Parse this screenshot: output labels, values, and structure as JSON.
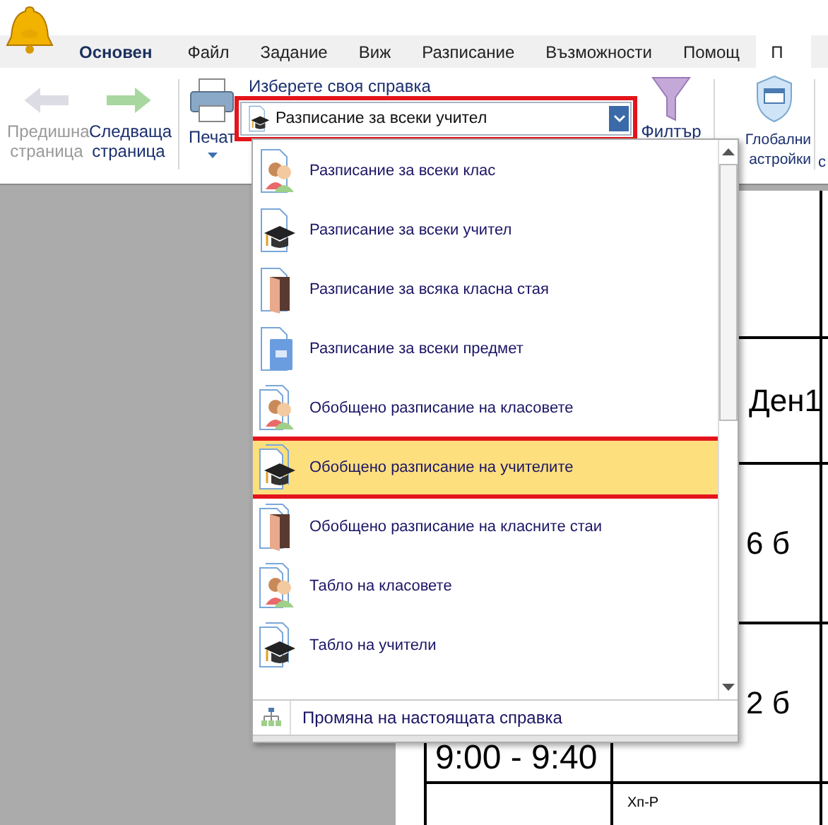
{
  "tabs": [
    {
      "label": "Основен",
      "kind": "app",
      "selected": false
    },
    {
      "label": "Файл",
      "kind": "tab",
      "selected": false
    },
    {
      "label": "Задание",
      "kind": "tab",
      "selected": false
    },
    {
      "label": "Виж",
      "kind": "tab",
      "selected": false
    },
    {
      "label": "Разписание",
      "kind": "tab",
      "selected": false
    },
    {
      "label": "Възможности",
      "kind": "tab",
      "selected": false
    },
    {
      "label": "Помощ",
      "kind": "tab",
      "selected": false
    },
    {
      "label": "П",
      "kind": "tab",
      "selected": true
    }
  ],
  "ribbon": {
    "buttons": [
      {
        "label": "Предишна страница",
        "kind": "prev",
        "disabled": true
      },
      {
        "label": "Следваща страница",
        "kind": "next",
        "disabled": false
      },
      {
        "label": "Печат",
        "kind": "print",
        "disabled": false
      }
    ],
    "report_label": "Изберете своя справка",
    "report_combo": {
      "value": "Разписание за всеки учител",
      "kind": "teacher",
      "highlighted": true
    },
    "right_buttons": [
      {
        "label": "Филтър",
        "kind": "filter"
      },
      {
        "label": "Глобални астройки",
        "kind": "shield"
      },
      {
        "label": "с",
        "kind": "partial"
      }
    ]
  },
  "dropdown": {
    "items": [
      {
        "label": "Разписание за всеки клас",
        "kind": "class",
        "summary": false,
        "selected": false
      },
      {
        "label": "Разписание за всеки учител",
        "kind": "teacher",
        "summary": false,
        "selected": false
      },
      {
        "label": "Разписание за всяка класна стая",
        "kind": "room",
        "summary": false,
        "selected": false
      },
      {
        "label": "Разписание за всеки предмет",
        "kind": "subject",
        "summary": false,
        "selected": false
      },
      {
        "label": "Обобщено разписание на класовете",
        "kind": "class",
        "summary": true,
        "selected": false
      },
      {
        "label": "Обобщено разписание на учителите",
        "kind": "teacher",
        "summary": true,
        "selected": true
      },
      {
        "label": "Обобщено разписание на класните стаи",
        "kind": "room",
        "summary": true,
        "selected": false
      },
      {
        "label": "Табло на класовете",
        "kind": "class",
        "summary": true,
        "selected": false
      },
      {
        "label": "Табло на учители",
        "kind": "teacher",
        "summary": true,
        "selected": false
      }
    ],
    "footer": "Промяна на настоящата справка"
  },
  "page": {
    "rows": [
      [
        "",
        ""
      ],
      [
        "",
        "Ден1"
      ],
      [
        "",
        "6 б"
      ],
      [
        "9:00 - 9:40",
        "2 б"
      ],
      [
        "",
        "Хп-Р"
      ]
    ]
  }
}
